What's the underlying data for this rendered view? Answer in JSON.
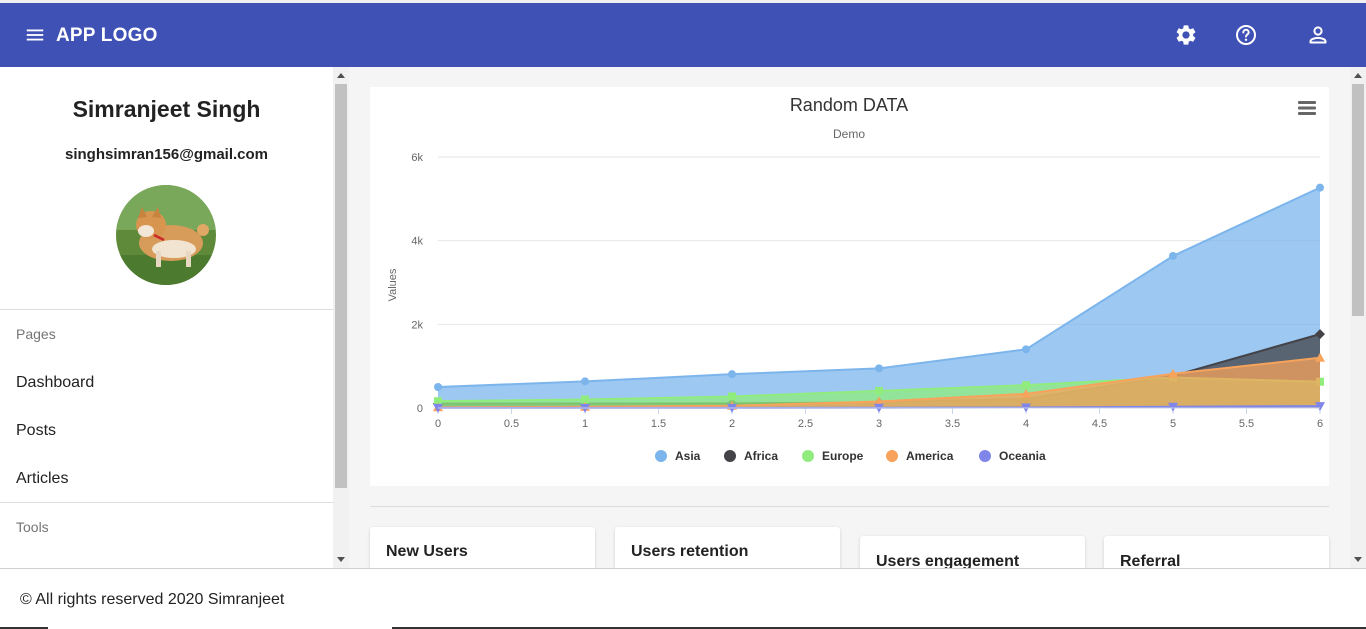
{
  "header": {
    "logo": "APP LOGO",
    "icons": [
      "menu-icon",
      "settings-icon",
      "help-icon",
      "account-icon"
    ]
  },
  "sidebar": {
    "user_name": "Simranjeet Singh",
    "user_email": "singhsimran156@gmail.com",
    "sections": [
      {
        "title": "Pages",
        "items": [
          "Dashboard",
          "Posts",
          "Articles"
        ]
      },
      {
        "title": "Tools",
        "items": []
      }
    ]
  },
  "chart_data": {
    "type": "area",
    "title": "Random DATA",
    "subtitle": "Demo",
    "ylabel": "Values",
    "xlabel": "",
    "x_ticks": [
      "0",
      "0.5",
      "1",
      "1.5",
      "2",
      "2.5",
      "3",
      "3.5",
      "4",
      "4.5",
      "5",
      "5.5",
      "6"
    ],
    "y_ticks": [
      "0",
      "2k",
      "4k",
      "6k"
    ],
    "xlim": [
      0,
      6
    ],
    "ylim": [
      0,
      6000
    ],
    "x": [
      0,
      1,
      2,
      3,
      4,
      5,
      6
    ],
    "grid": "horizontal",
    "legend_position": "bottom",
    "series": [
      {
        "name": "Asia",
        "color": "#7cb5ec",
        "marker": "circle",
        "values": [
          502,
          635,
          809,
          947,
          1402,
          3634,
          5268
        ]
      },
      {
        "name": "Africa",
        "color": "#434348",
        "marker": "diamond",
        "values": [
          106,
          107,
          111,
          133,
          221,
          767,
          1766
        ]
      },
      {
        "name": "Europe",
        "color": "#90ed7d",
        "marker": "square",
        "values": [
          163,
          203,
          276,
          408,
          547,
          729,
          628
        ]
      },
      {
        "name": "America",
        "color": "#f7a35c",
        "marker": "triangle",
        "values": [
          18,
          31,
          54,
          156,
          339,
          818,
          1201
        ]
      },
      {
        "name": "Oceania",
        "color": "#8085e9",
        "marker": "triangle-down",
        "values": [
          2,
          2,
          2,
          6,
          13,
          30,
          46
        ]
      }
    ]
  },
  "cards": [
    "New Users",
    "Users retention",
    "Users engagement",
    "Referral"
  ],
  "footer": {
    "text": "© All rights reserved 2020 Simranjeet"
  },
  "colors": {
    "primary": "#3f51b5",
    "background": "#f5f5f5"
  }
}
